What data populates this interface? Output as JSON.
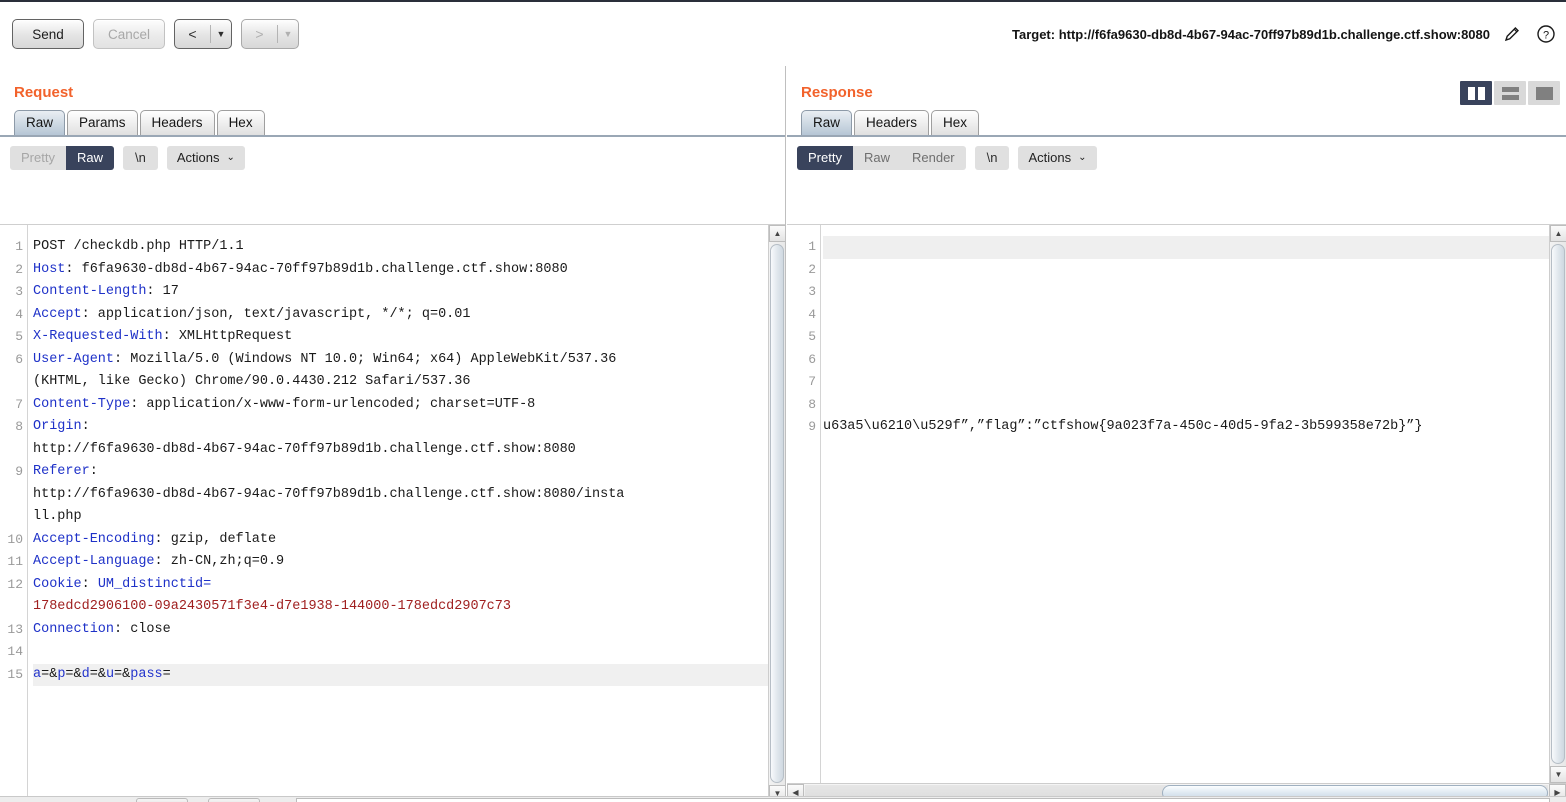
{
  "toolbar": {
    "send_label": "Send",
    "cancel_label": "Cancel",
    "prev_arrow": "<",
    "next_arrow": ">",
    "caret": "▼",
    "target_label": "Target: http://f6fa9630-db8d-4b67-94ac-70ff97b89d1b.challenge.ctf.show:8080",
    "edit_icon": "pencil-icon",
    "help_icon": "question-mark-icon"
  },
  "request": {
    "title": "Request",
    "tabs": [
      {
        "label": "Raw",
        "active": true
      },
      {
        "label": "Params",
        "active": false
      },
      {
        "label": "Headers",
        "active": false
      },
      {
        "label": "Hex",
        "active": false
      }
    ],
    "view_modes": [
      {
        "label": "Pretty",
        "state": "dim"
      },
      {
        "label": "Raw",
        "state": "on"
      }
    ],
    "newline_label": "\\n",
    "actions_label": "Actions",
    "actions_caret": "⌄",
    "lines": [
      {
        "n": "1",
        "segs": [
          {
            "t": "POST /checkdb.php HTTP/1.1",
            "c": "val"
          }
        ]
      },
      {
        "n": "2",
        "segs": [
          {
            "t": "Host",
            "c": "hdr"
          },
          {
            "t": ": f6fa9630-db8d-4b67-94ac-70ff97b89d1b.challenge.ctf.show:8080",
            "c": "val"
          }
        ]
      },
      {
        "n": "3",
        "segs": [
          {
            "t": "Content-Length",
            "c": "hdr"
          },
          {
            "t": ": 17",
            "c": "val"
          }
        ]
      },
      {
        "n": "4",
        "segs": [
          {
            "t": "Accept",
            "c": "hdr"
          },
          {
            "t": ": application/json, text/javascript, */*; q=0.01",
            "c": "val"
          }
        ]
      },
      {
        "n": "5",
        "segs": [
          {
            "t": "X-Requested-With",
            "c": "hdr"
          },
          {
            "t": ": XMLHttpRequest",
            "c": "val"
          }
        ]
      },
      {
        "n": "6",
        "segs": [
          {
            "t": "User-Agent",
            "c": "hdr"
          },
          {
            "t": ": Mozilla/5.0 (Windows NT 10.0; Win64; x64) AppleWebKit/537.36",
            "c": "val"
          }
        ]
      },
      {
        "n": "",
        "segs": [
          {
            "t": "(KHTML, like Gecko) Chrome/90.0.4430.212 Safari/537.36",
            "c": "val"
          }
        ]
      },
      {
        "n": "7",
        "segs": [
          {
            "t": "Content-Type",
            "c": "hdr"
          },
          {
            "t": ": application/x-www-form-urlencoded; charset=UTF-8",
            "c": "val"
          }
        ]
      },
      {
        "n": "8",
        "segs": [
          {
            "t": "Origin",
            "c": "hdr"
          },
          {
            "t": ":",
            "c": "val"
          }
        ]
      },
      {
        "n": "",
        "segs": [
          {
            "t": "http://f6fa9630-db8d-4b67-94ac-70ff97b89d1b.challenge.ctf.show:8080",
            "c": "val"
          }
        ]
      },
      {
        "n": "9",
        "segs": [
          {
            "t": "Referer",
            "c": "hdr"
          },
          {
            "t": ":",
            "c": "val"
          }
        ]
      },
      {
        "n": "",
        "segs": [
          {
            "t": "http://f6fa9630-db8d-4b67-94ac-70ff97b89d1b.challenge.ctf.show:8080/insta",
            "c": "val"
          }
        ]
      },
      {
        "n": "",
        "segs": [
          {
            "t": "ll.php",
            "c": "val"
          }
        ]
      },
      {
        "n": "10",
        "segs": [
          {
            "t": "Accept-Encoding",
            "c": "hdr"
          },
          {
            "t": ": gzip, deflate",
            "c": "val"
          }
        ]
      },
      {
        "n": "11",
        "segs": [
          {
            "t": "Accept-Language",
            "c": "hdr"
          },
          {
            "t": ": zh-CN,zh;q=0.9",
            "c": "val"
          }
        ]
      },
      {
        "n": "12",
        "segs": [
          {
            "t": "Cookie",
            "c": "hdr"
          },
          {
            "t": ": ",
            "c": "val"
          },
          {
            "t": "UM_distinctid=",
            "c": "hdr"
          }
        ]
      },
      {
        "n": "",
        "segs": [
          {
            "t": "178edcd2906100-09a2430571f3e4-d7e1938-144000-178edcd2907c73",
            "c": "ckv"
          }
        ]
      },
      {
        "n": "13",
        "segs": [
          {
            "t": "Connection",
            "c": "hdr"
          },
          {
            "t": ": close",
            "c": "val"
          }
        ]
      },
      {
        "n": "14",
        "segs": [
          {
            "t": "",
            "c": "val"
          }
        ]
      },
      {
        "n": "15",
        "hl": true,
        "segs": [
          {
            "t": "a",
            "c": "prm"
          },
          {
            "t": "=&",
            "c": "val"
          },
          {
            "t": "p",
            "c": "prm"
          },
          {
            "t": "=&",
            "c": "val"
          },
          {
            "t": "d",
            "c": "prm"
          },
          {
            "t": "=&",
            "c": "val"
          },
          {
            "t": "u",
            "c": "prm"
          },
          {
            "t": "=&",
            "c": "val"
          },
          {
            "t": "pass",
            "c": "prm"
          },
          {
            "t": "=",
            "c": "val"
          }
        ]
      }
    ]
  },
  "response": {
    "title": "Response",
    "tabs": [
      {
        "label": "Raw",
        "active": true
      },
      {
        "label": "Headers",
        "active": false
      },
      {
        "label": "Hex",
        "active": false
      }
    ],
    "view_modes": [
      {
        "label": "Pretty",
        "state": "on"
      },
      {
        "label": "Raw",
        "state": "off"
      },
      {
        "label": "Render",
        "state": "off"
      }
    ],
    "newline_label": "\\n",
    "actions_label": "Actions",
    "actions_caret": "⌄",
    "layout_buttons": [
      {
        "name": "layout-split-vertical",
        "active": true
      },
      {
        "name": "layout-split-horizontal",
        "active": false
      },
      {
        "name": "layout-single-pane",
        "active": false
      }
    ],
    "lines": [
      {
        "n": "1",
        "hl": true,
        "text": ""
      },
      {
        "n": "2",
        "text": ""
      },
      {
        "n": "3",
        "text": ""
      },
      {
        "n": "4",
        "text": ""
      },
      {
        "n": "5",
        "text": ""
      },
      {
        "n": "6",
        "text": ""
      },
      {
        "n": "7",
        "text": ""
      },
      {
        "n": "8",
        "text": ""
      },
      {
        "n": "9",
        "text": "u63a5\\u6210\\u529f”,”flag”:”ctfshow{9a023f7a-450c-40d5-9fa2-3b599358e72b}”}"
      }
    ],
    "flag": "ctfshow{9a023f7a-450c-40d5-9fa2-3b599358e72b}"
  },
  "colors": {
    "panel_title": "#f2622b",
    "header_key": "#1e31c8",
    "cookie_value": "#a02020",
    "active_segment": "#39435c",
    "tab_active": "#b6c6d5"
  },
  "scroll": {
    "left_arrow": "◀",
    "right_arrow": "▶",
    "up_arrow": "▲",
    "down_arrow": "▼"
  }
}
